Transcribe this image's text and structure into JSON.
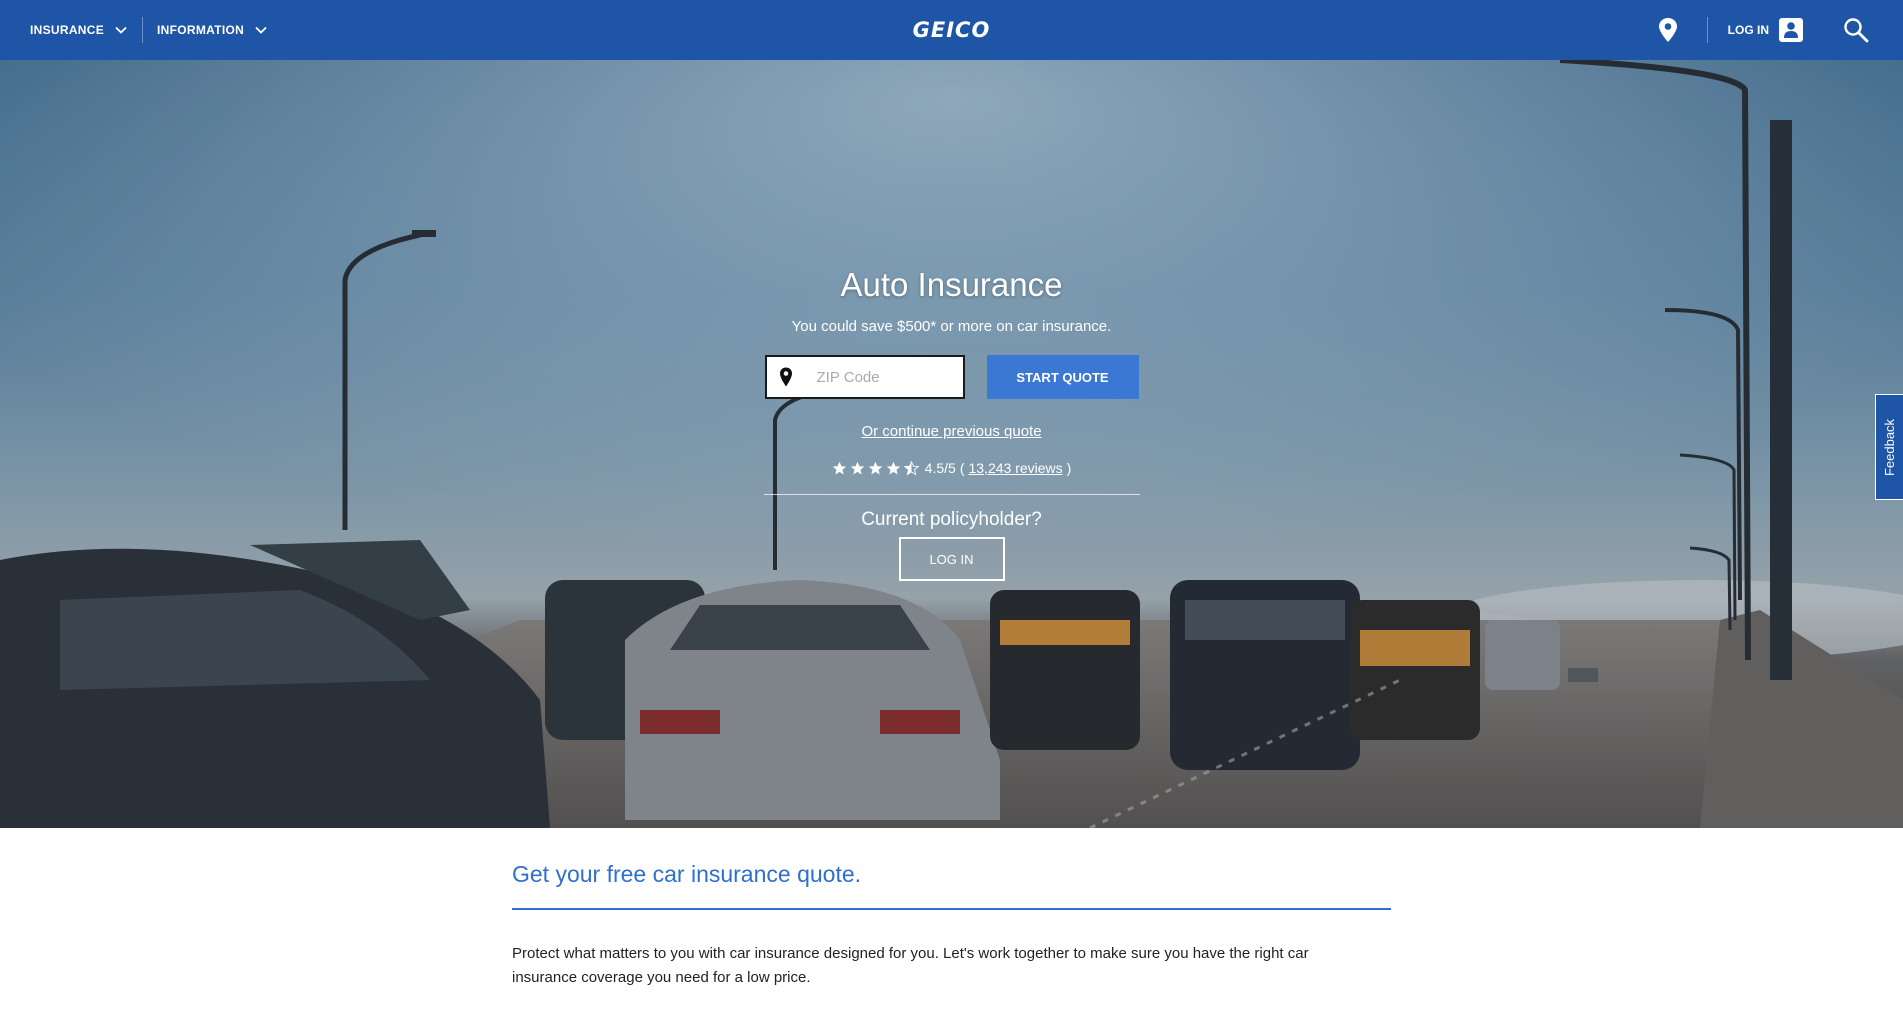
{
  "nav": {
    "insurance_label": "INSURANCE",
    "information_label": "INFORMATION",
    "brand": "GEICO",
    "login_label": "LOG IN",
    "icons": [
      "chevron-down-icon",
      "location-pin-icon",
      "user-icon",
      "search-icon"
    ]
  },
  "hero": {
    "title": "Auto Insurance",
    "subtitle": "You could save $500* or more on car insurance.",
    "zip_placeholder": "ZIP Code",
    "zip_value": "",
    "start_quote_label": "START QUOTE",
    "continue_link": "Or continue previous quote",
    "rating": {
      "value": 4.5,
      "max": 5,
      "text": "4.5/5",
      "reviews_text": "13,243 reviews",
      "open_paren": "(",
      "close_paren": ")"
    },
    "policyholder_question": "Current policyholder?",
    "login_button_label": "LOG IN"
  },
  "feedback": {
    "label": "Feedback"
  },
  "content": {
    "heading": "Get your free car insurance quote.",
    "paragraph": "Protect what matters to you with car insurance designed for you. Let's work together to make sure you have the right car insurance coverage you need for a low price."
  },
  "colors": {
    "nav_bg": "#1f55a6",
    "accent_blue": "#3a78d4",
    "heading_blue": "#2e6fcf"
  }
}
